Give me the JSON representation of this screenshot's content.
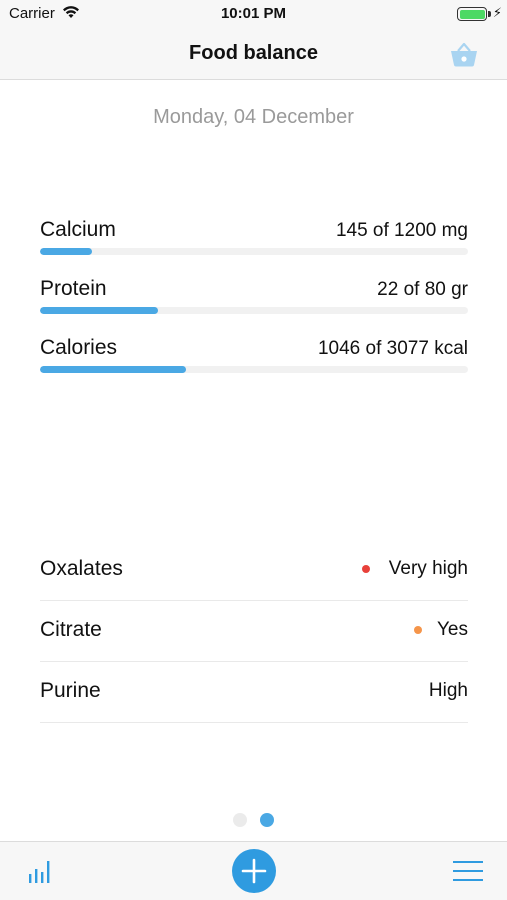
{
  "status_bar": {
    "carrier": "Carrier",
    "time": "10:01 PM",
    "wifi_icon": "wifi-icon",
    "battery_icon": "battery-icon",
    "charging_icon": "charging-bolt-icon",
    "battery_level": 1.0
  },
  "nav": {
    "title": "Food balance",
    "basket_icon": "basket-icon"
  },
  "date": "Monday, 04 December",
  "nutrients": [
    {
      "label": "Calcium",
      "amount": "145 of 1200 mg",
      "progress": 0.121
    },
    {
      "label": "Protein",
      "amount": "22 of 80 gr",
      "progress": 0.275
    },
    {
      "label": "Calories",
      "amount": "1046 of 3077 kcal",
      "progress": 0.34
    }
  ],
  "properties": [
    {
      "label": "Oxalates",
      "value": "Very high",
      "dot_color": "#e8413a"
    },
    {
      "label": "Citrate",
      "value": "Yes",
      "dot_color": "#f5954a"
    },
    {
      "label": "Purine",
      "value": "High"
    }
  ],
  "pager": {
    "count": 2,
    "current": 2
  },
  "tab_bar": {
    "stats_icon": "bar-chart-icon",
    "add_icon": "plus-icon",
    "menu_icon": "hamburger-menu-icon"
  },
  "colors": {
    "accent": "#4aa8e4",
    "add_button": "#2f9be0",
    "track": "#f1f1f1",
    "muted_text": "#9a9a9a",
    "pager_inactive": "#ebebeb",
    "battery": "#4cd964"
  }
}
